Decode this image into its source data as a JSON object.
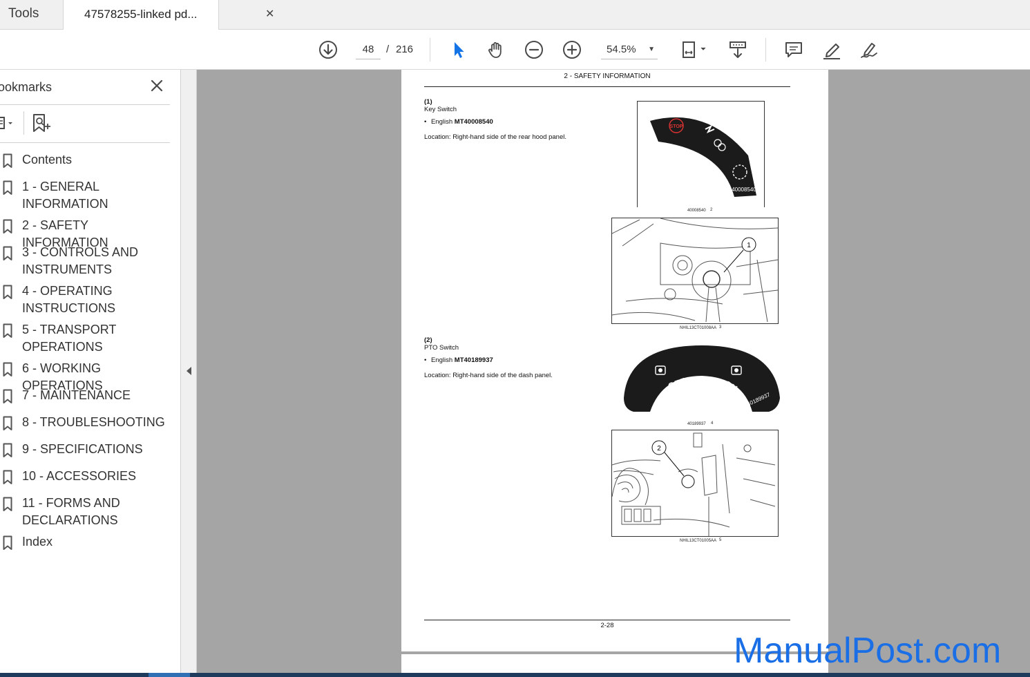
{
  "tabs": {
    "tools_label": "Tools",
    "doc_label": "47578255-linked pd...",
    "close_glyph": "✕"
  },
  "toolbar": {
    "current_page": "48",
    "page_sep": "/",
    "total_pages": "216",
    "zoom": "54.5%",
    "icons": [
      "download-icon",
      "select-arrow-icon",
      "hand-icon",
      "zoom-out-icon",
      "zoom-in-icon",
      "fit-page-icon",
      "scroll-mode-icon",
      "comment-icon",
      "highlight-icon",
      "sign-icon"
    ],
    "accent": "#1473e6"
  },
  "sidebar": {
    "title": "ookmarks",
    "items": [
      {
        "label": "Contents"
      },
      {
        "label": "1 - GENERAL INFORMATION"
      },
      {
        "label": "2 - SAFETY INFORMATION"
      },
      {
        "label": "3 - CONTROLS AND INSTRUMENTS"
      },
      {
        "label": "4 - OPERATING INSTRUCTIONS"
      },
      {
        "label": "5 - TRANSPORT OPERATIONS"
      },
      {
        "label": "6 - WORKING OPERATIONS"
      },
      {
        "label": "7 - MAINTENANCE"
      },
      {
        "label": "8 - TROUBLESHOOTING"
      },
      {
        "label": "9 - SPECIFICATIONS"
      },
      {
        "label": "10 - ACCESSORIES"
      },
      {
        "label": "11 - FORMS AND DECLARATIONS"
      },
      {
        "label": "Index"
      }
    ]
  },
  "page": {
    "header": "2 - SAFETY INFORMATION",
    "s1_num": "(1)",
    "s1_title": "Key Switch",
    "s1_lang_prefix": "English ",
    "s1_code": "MT40008540",
    "s1_location": "Location: Right-hand side of the rear hood panel.",
    "decal1_text": "40008540",
    "decal1_stop": "STOP",
    "fig2_cap": "40008540",
    "fig2_num": "2",
    "fig3_callout": "1",
    "fig3_cap": "NHIL13CT01008AA",
    "fig3_num": "3",
    "s2_num": "(2)",
    "s2_title": "PTO Switch",
    "s2_lang_prefix": "English ",
    "s2_code": "MT40189937",
    "s2_location": "Location: Right-hand side of the dash panel.",
    "decal2_off": "OFF",
    "decal2_on": "ON",
    "decal2_text": "40189937",
    "fig4_cap": "40189937",
    "fig4_num": "4",
    "fig5_callout": "2",
    "fig5_cap": "NHIL13CT01005AA",
    "fig5_num": "5",
    "page_number": "2-28"
  },
  "watermark": "ManualPost.com"
}
